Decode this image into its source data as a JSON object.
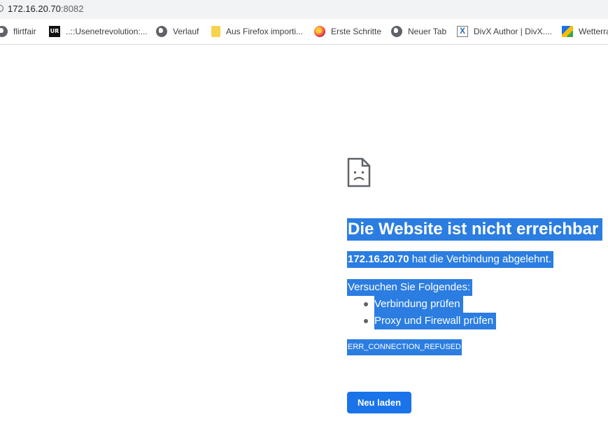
{
  "address_bar": {
    "host": "172.16.20.70",
    "port": ":8082"
  },
  "bookmarks": [
    {
      "label": "flirtfair",
      "icon": "globe-icon"
    },
    {
      "label": "..::Usenetrevolution:...",
      "icon": "ur-site-icon",
      "icon_text": "UR"
    },
    {
      "label": "Verlauf",
      "icon": "globe-icon"
    },
    {
      "label": "Aus Firefox importi...",
      "icon": "folder-icon"
    },
    {
      "label": "Erste Schritte",
      "icon": "firefox-icon"
    },
    {
      "label": "Neuer Tab",
      "icon": "globe-icon"
    },
    {
      "label": "DivX Author | DivX....",
      "icon": "divx-icon",
      "icon_text": "X"
    },
    {
      "label": "Wetterra",
      "icon": "wetter-icon"
    }
  ],
  "error_page": {
    "icon": "sad-page-icon",
    "title": "Die Website ist nicht erreichbar",
    "host": "172.16.20.70",
    "detail_rest": " hat die Verbindung abgelehnt.",
    "suggestions_heading": "Versuchen Sie Folgendes:",
    "suggestions": [
      "Verbindung prüfen",
      "Proxy und Firewall prüfen"
    ],
    "error_code": "ERR_CONNECTION_REFUSED",
    "reload_button": "Neu laden"
  },
  "colors": {
    "selection": "#2b7de1",
    "button": "#1a73e8",
    "omnibox_bg": "#f1f3f4"
  }
}
